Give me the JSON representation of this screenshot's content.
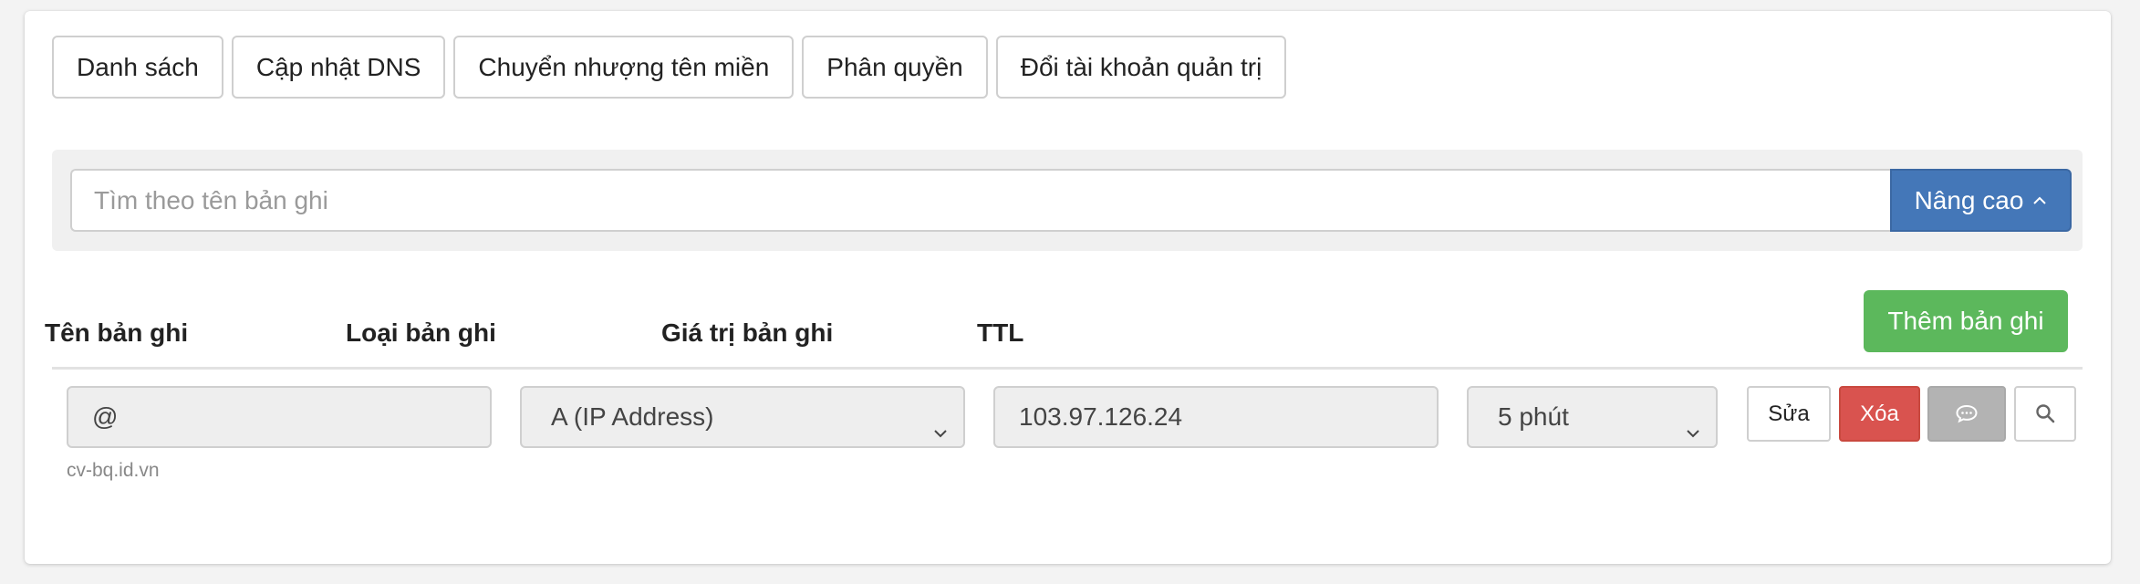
{
  "tabs": [
    {
      "label": "Danh sách"
    },
    {
      "label": "Cập nhật DNS"
    },
    {
      "label": "Chuyển nhượng tên miền"
    },
    {
      "label": "Phân quyền"
    },
    {
      "label": "Đổi tài khoản quản trị"
    }
  ],
  "search": {
    "placeholder": "Tìm theo tên bản ghi",
    "advanced_label": "Nâng cao",
    "advanced_icon": "chevron-up-icon"
  },
  "table": {
    "headers": {
      "name": "Tên bản ghi",
      "type": "Loại bản ghi",
      "value": "Giá trị bản ghi",
      "ttl": "TTL"
    },
    "add_button": "Thêm bản ghi"
  },
  "record": {
    "name": "@",
    "name_hint": "cv-bq.id.vn",
    "type": "A (IP Address)",
    "value": "103.97.126.24",
    "ttl": "5 phút",
    "actions": {
      "edit": "Sửa",
      "delete": "Xóa",
      "note_icon": "comment-icon",
      "search_icon": "search-icon"
    }
  },
  "colors": {
    "primary": "#4477b8",
    "success": "#5cb85c",
    "danger": "#d9534f",
    "muted": "#b3b3b3"
  }
}
